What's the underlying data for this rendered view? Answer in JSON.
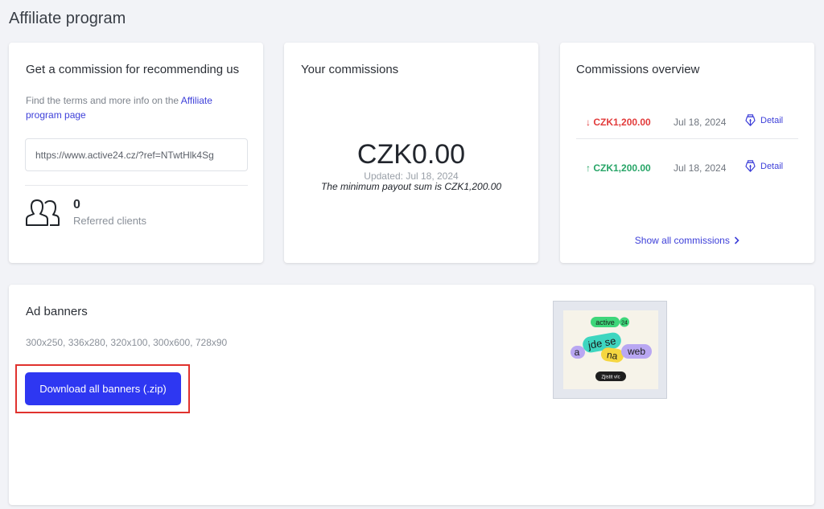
{
  "page": {
    "title": "Affiliate program"
  },
  "recommend": {
    "title": "Get a commission for recommending us",
    "terms_prefix": "Find the terms and more info on the ",
    "terms_link": "Affiliate program page",
    "referral_url": "https://www.active24.cz/?ref=NTwtHlk4Sg",
    "referred_count": "0",
    "referred_label": "Referred clients",
    "icon": "users-icon"
  },
  "commissions": {
    "title": "Your commissions",
    "balance": "CZK0.00",
    "updated": "Updated: Jul 18, 2024",
    "min_payout": "The minimum payout sum is CZK1,200.00"
  },
  "overview": {
    "title": "Commissions overview",
    "rows": [
      {
        "arrow": "↓",
        "amount": "CZK1,200.00",
        "direction": "out",
        "date": "Jul 18, 2024",
        "detail_label": "Detail"
      },
      {
        "arrow": "↑",
        "amount": "CZK1,200.00",
        "direction": "in",
        "date": "Jul 18, 2024",
        "detail_label": "Detail"
      }
    ],
    "show_all": "Show all commissions"
  },
  "banners": {
    "title": "Ad banners",
    "sizes": "300x250, 336x280, 320x100, 300x600, 728x90",
    "download_label": "Download all banners (.zip)",
    "preview": {
      "brand": "active",
      "brand_num": "24",
      "words": [
        "a",
        "jde se",
        "na",
        "web"
      ],
      "cta": "Zjistit víc"
    }
  },
  "colors": {
    "accent": "#2e37f2",
    "link": "#3d3fd9",
    "negative": "#e23b3b",
    "positive": "#27a567",
    "highlight": "#e0322e"
  }
}
